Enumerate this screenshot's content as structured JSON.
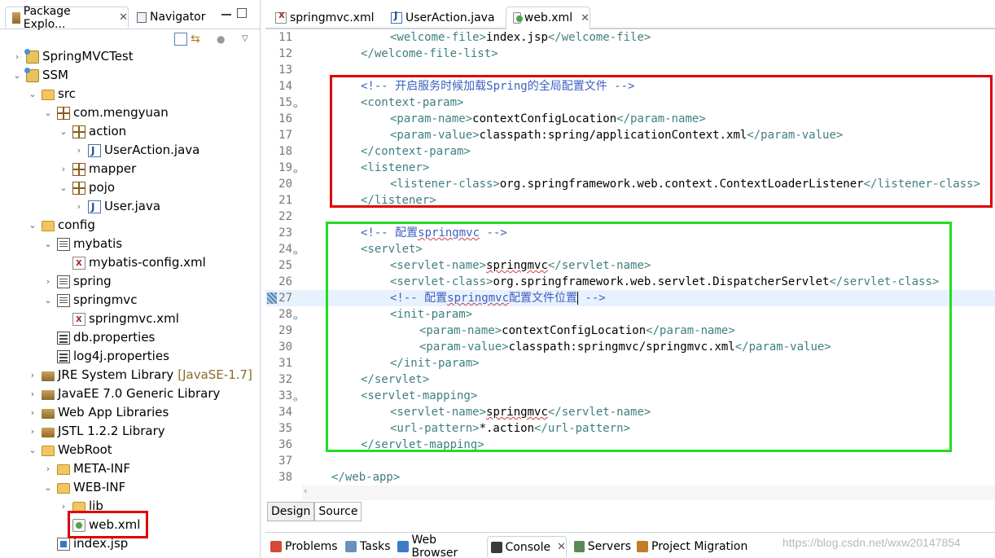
{
  "explorer": {
    "tabs": [
      {
        "label": "Package Explo...",
        "active": true
      },
      {
        "label": "Navigator",
        "active": false
      }
    ],
    "tree": [
      {
        "label": "SpringMVCTest",
        "depth": 0,
        "arrow": "›",
        "icon": "project-icon"
      },
      {
        "label": "SSM",
        "depth": 0,
        "arrow": "⌄",
        "icon": "project-icon"
      },
      {
        "label": "src",
        "depth": 1,
        "arrow": "⌄",
        "icon": "source-folder-icon"
      },
      {
        "label": "com.mengyuan",
        "depth": 2,
        "arrow": "⌄",
        "icon": "package-icon"
      },
      {
        "label": "action",
        "depth": 3,
        "arrow": "⌄",
        "icon": "package-icon"
      },
      {
        "label": "UserAction.java",
        "depth": 4,
        "arrow": "›",
        "icon": "java-file-icon"
      },
      {
        "label": "mapper",
        "depth": 3,
        "arrow": "›",
        "icon": "package-icon"
      },
      {
        "label": "pojo",
        "depth": 3,
        "arrow": "⌄",
        "icon": "package-icon"
      },
      {
        "label": "User.java",
        "depth": 4,
        "arrow": "›",
        "icon": "java-file-icon"
      },
      {
        "label": "config",
        "depth": 1,
        "arrow": "⌄",
        "icon": "source-folder-icon"
      },
      {
        "label": "mybatis",
        "depth": 2,
        "arrow": "⌄",
        "icon": "package-light-icon"
      },
      {
        "label": "mybatis-config.xml",
        "depth": 3,
        "arrow": "",
        "icon": "xml-file-icon"
      },
      {
        "label": "spring",
        "depth": 2,
        "arrow": "›",
        "icon": "package-light-icon"
      },
      {
        "label": "springmvc",
        "depth": 2,
        "arrow": "⌄",
        "icon": "package-light-icon"
      },
      {
        "label": "springmvc.xml",
        "depth": 3,
        "arrow": "",
        "icon": "xml-file-icon"
      },
      {
        "label": "db.properties",
        "depth": 2,
        "arrow": "",
        "icon": "properties-file-icon"
      },
      {
        "label": "log4j.properties",
        "depth": 2,
        "arrow": "",
        "icon": "properties-file-icon"
      },
      {
        "label": "JRE System Library",
        "depth": 1,
        "arrow": "›",
        "icon": "library-icon",
        "decoration": "[JavaSE-1.7]"
      },
      {
        "label": "JavaEE 7.0 Generic Library",
        "depth": 1,
        "arrow": "›",
        "icon": "library-icon"
      },
      {
        "label": "Web App Libraries",
        "depth": 1,
        "arrow": "›",
        "icon": "library-icon"
      },
      {
        "label": "JSTL 1.2.2 Library",
        "depth": 1,
        "arrow": "›",
        "icon": "library-icon"
      },
      {
        "label": "WebRoot",
        "depth": 1,
        "arrow": "⌄",
        "icon": "folder-icon"
      },
      {
        "label": "META-INF",
        "depth": 2,
        "arrow": "›",
        "icon": "folder-icon"
      },
      {
        "label": "WEB-INF",
        "depth": 2,
        "arrow": "⌄",
        "icon": "folder-icon"
      },
      {
        "label": "lib",
        "depth": 3,
        "arrow": "›",
        "icon": "folder-icon"
      },
      {
        "label": "web.xml",
        "depth": 3,
        "arrow": "",
        "icon": "web-xml-file-icon",
        "highlighted": true
      },
      {
        "label": "index.jsp",
        "depth": 2,
        "arrow": "",
        "icon": "jsp-file-icon"
      }
    ]
  },
  "editor": {
    "tabs": [
      {
        "label": "springmvc.xml",
        "active": false
      },
      {
        "label": "UserAction.java",
        "active": false
      },
      {
        "label": "web.xml",
        "active": true
      }
    ],
    "current_line": 27,
    "lines": [
      {
        "n": "11",
        "indent": 2,
        "parts": [
          [
            "tg",
            "<welcome-file>"
          ],
          [
            "tx",
            "index.jsp"
          ],
          [
            "tg",
            "</welcome-file>"
          ]
        ]
      },
      {
        "n": "12",
        "indent": 1,
        "parts": [
          [
            "tg",
            "</welcome-file-list>"
          ]
        ]
      },
      {
        "n": "13",
        "indent": 0,
        "parts": []
      },
      {
        "n": "14",
        "indent": 1,
        "parts": [
          [
            "cm",
            "<!-- 开启服务时候加载Spring的全局配置文件 -->"
          ]
        ]
      },
      {
        "n": "15",
        "indent": 1,
        "fold": true,
        "parts": [
          [
            "tg",
            "<context-param>"
          ]
        ]
      },
      {
        "n": "16",
        "indent": 2,
        "parts": [
          [
            "tg",
            "<param-name>"
          ],
          [
            "tx",
            "contextConfigLocation"
          ],
          [
            "tg",
            "</param-name>"
          ]
        ]
      },
      {
        "n": "17",
        "indent": 2,
        "parts": [
          [
            "tg",
            "<param-value>"
          ],
          [
            "tx",
            "classpath:spring/applicationContext.xml"
          ],
          [
            "tg",
            "</param-value>"
          ]
        ]
      },
      {
        "n": "18",
        "indent": 1,
        "parts": [
          [
            "tg",
            "</context-param>"
          ]
        ]
      },
      {
        "n": "19",
        "indent": 1,
        "fold": true,
        "parts": [
          [
            "tg",
            "<listener>"
          ]
        ]
      },
      {
        "n": "20",
        "indent": 2,
        "parts": [
          [
            "tg",
            "<listener-class>"
          ],
          [
            "tx",
            "org.springframework.web.context.ContextLoaderListener"
          ],
          [
            "tg",
            "</listener-class>"
          ]
        ]
      },
      {
        "n": "21",
        "indent": 1,
        "parts": [
          [
            "tg",
            "</listener>"
          ]
        ]
      },
      {
        "n": "22",
        "indent": 0,
        "parts": []
      },
      {
        "n": "23",
        "indent": 1,
        "parts": [
          [
            "cm",
            "<!-- 配置"
          ],
          [
            "cm sq",
            "springmvc"
          ],
          [
            "cm",
            " -->"
          ]
        ]
      },
      {
        "n": "24",
        "indent": 1,
        "fold": true,
        "parts": [
          [
            "tg",
            "<servlet>"
          ]
        ]
      },
      {
        "n": "25",
        "indent": 2,
        "parts": [
          [
            "tg",
            "<servlet-name>"
          ],
          [
            "tx sq",
            "springmvc"
          ],
          [
            "tg",
            "</servlet-name>"
          ]
        ]
      },
      {
        "n": "26",
        "indent": 2,
        "parts": [
          [
            "tg",
            "<servlet-class>"
          ],
          [
            "tx",
            "org.springframework.web.servlet.DispatcherServlet"
          ],
          [
            "tg",
            "</servlet-class>"
          ]
        ]
      },
      {
        "n": "27",
        "indent": 2,
        "bookmark": true,
        "parts": [
          [
            "cm",
            "<!-- 配置"
          ],
          [
            "cm sq",
            "springmvc"
          ],
          [
            "cm",
            "配置文件位置"
          ],
          [
            "caret",
            ""
          ],
          [
            "cm",
            " -->"
          ]
        ]
      },
      {
        "n": "28",
        "indent": 2,
        "fold": true,
        "parts": [
          [
            "tg",
            "<init-param>"
          ]
        ]
      },
      {
        "n": "29",
        "indent": 3,
        "parts": [
          [
            "tg",
            "<param-name>"
          ],
          [
            "tx",
            "contextConfigLocation"
          ],
          [
            "tg",
            "</param-name>"
          ]
        ]
      },
      {
        "n": "30",
        "indent": 3,
        "parts": [
          [
            "tg",
            "<param-value>"
          ],
          [
            "tx",
            "classpath:springmvc/springmvc.xml"
          ],
          [
            "tg",
            "</param-value>"
          ]
        ]
      },
      {
        "n": "31",
        "indent": 2,
        "parts": [
          [
            "tg",
            "</init-param>"
          ]
        ]
      },
      {
        "n": "32",
        "indent": 1,
        "parts": [
          [
            "tg",
            "</servlet>"
          ]
        ]
      },
      {
        "n": "33",
        "indent": 1,
        "fold": true,
        "parts": [
          [
            "tg",
            "<servlet-mapping>"
          ]
        ]
      },
      {
        "n": "34",
        "indent": 2,
        "parts": [
          [
            "tg",
            "<servlet-name>"
          ],
          [
            "tx sq",
            "springmvc"
          ],
          [
            "tg",
            "</servlet-name>"
          ]
        ]
      },
      {
        "n": "35",
        "indent": 2,
        "parts": [
          [
            "tg",
            "<url-pattern>"
          ],
          [
            "tx",
            "*.action"
          ],
          [
            "tg",
            "</url-pattern>"
          ]
        ]
      },
      {
        "n": "36",
        "indent": 1,
        "parts": [
          [
            "tg",
            "</servlet-mapping>"
          ]
        ]
      },
      {
        "n": "37",
        "indent": 0,
        "parts": []
      },
      {
        "n": "38",
        "indent": 0,
        "parts": [
          [
            "tg",
            "</web-app>"
          ]
        ]
      }
    ],
    "mode_tabs": [
      {
        "label": "Design",
        "active": false
      },
      {
        "label": "Source",
        "active": true
      }
    ]
  },
  "bottom": {
    "tabs": [
      {
        "label": "Problems",
        "active": false,
        "icon": "problems-icon"
      },
      {
        "label": "Tasks",
        "active": false,
        "icon": "tasks-icon"
      },
      {
        "label": "Web Browser",
        "active": false,
        "icon": "globe-icon"
      },
      {
        "label": "Console",
        "active": true,
        "icon": "console-icon"
      },
      {
        "label": "Servers",
        "active": false,
        "icon": "servers-icon"
      },
      {
        "label": "Project Migration",
        "active": false,
        "icon": "migration-icon"
      }
    ],
    "watermark": "https://blog.csdn.net/wxw20147854"
  },
  "colors": {
    "tag": "#3f7f7f",
    "comment": "#3f5fbf",
    "highlight_red": "#e00000",
    "highlight_green": "#22dd22"
  }
}
